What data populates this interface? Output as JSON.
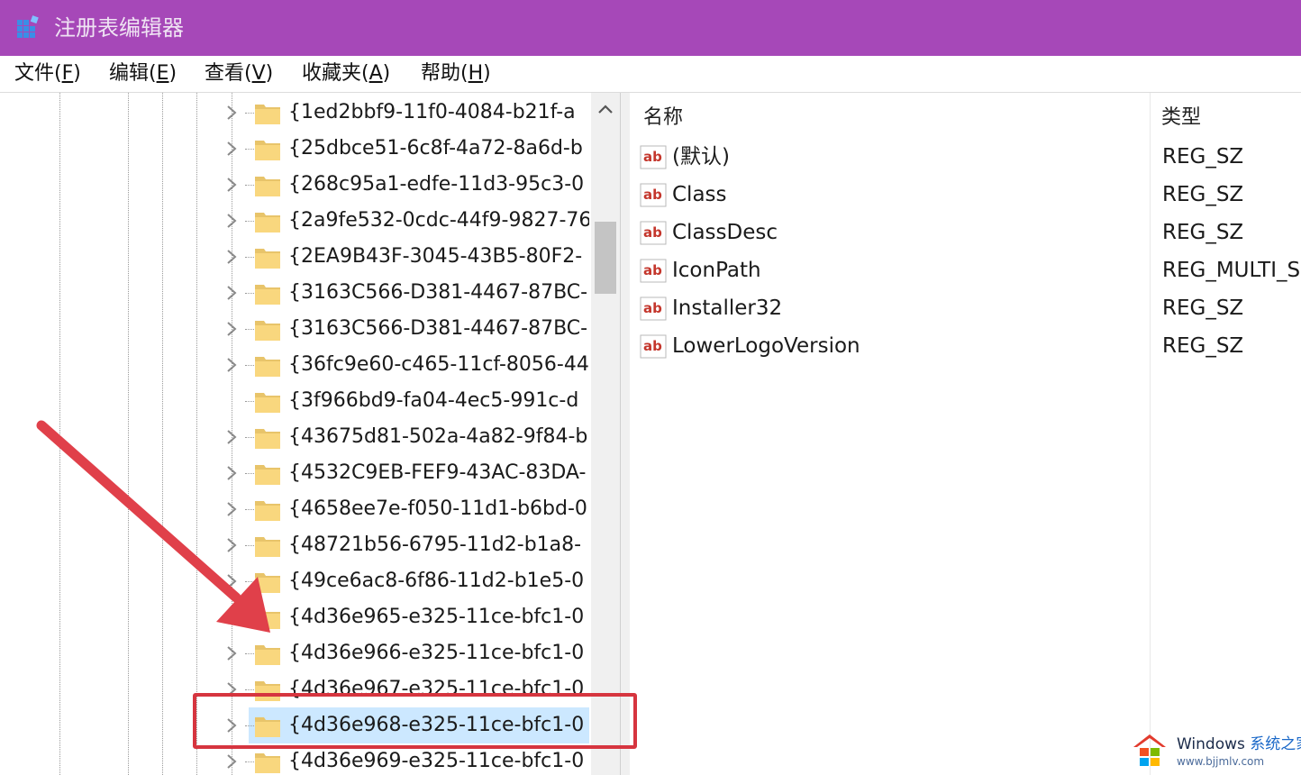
{
  "window": {
    "title": "注册表编辑器",
    "titlebar_color": "#a648b8"
  },
  "menu": [
    {
      "label": "文件(",
      "key": "F",
      "close": ")"
    },
    {
      "label": "编辑(",
      "key": "E",
      "close": ")"
    },
    {
      "label": "查看(",
      "key": "V",
      "close": ")"
    },
    {
      "label": "收藏夹(",
      "key": "A",
      "close": ")"
    },
    {
      "label": "帮助(",
      "key": "H",
      "close": ")"
    }
  ],
  "tree": {
    "items": [
      {
        "label": "{1ed2bbf9-11f0-4084-b21f-a",
        "expandable": true
      },
      {
        "label": "{25dbce51-6c8f-4a72-8a6d-b",
        "expandable": true
      },
      {
        "label": "{268c95a1-edfe-11d3-95c3-0",
        "expandable": true
      },
      {
        "label": "{2a9fe532-0cdc-44f9-9827-76",
        "expandable": true
      },
      {
        "label": "{2EA9B43F-3045-43B5-80F2-",
        "expandable": true
      },
      {
        "label": "{3163C566-D381-4467-87BC-",
        "expandable": true
      },
      {
        "label": "{3163C566-D381-4467-87BC-",
        "expandable": true
      },
      {
        "label": "{36fc9e60-c465-11cf-8056-44",
        "expandable": true
      },
      {
        "label": "{3f966bd9-fa04-4ec5-991c-d",
        "expandable": false
      },
      {
        "label": "{43675d81-502a-4a82-9f84-b",
        "expandable": true
      },
      {
        "label": "{4532C9EB-FEF9-43AC-83DA-",
        "expandable": true
      },
      {
        "label": "{4658ee7e-f050-11d1-b6bd-0",
        "expandable": true
      },
      {
        "label": "{48721b56-6795-11d2-b1a8-",
        "expandable": true
      },
      {
        "label": "{49ce6ac8-6f86-11d2-b1e5-0",
        "expandable": true
      },
      {
        "label": "{4d36e965-e325-11ce-bfc1-0",
        "expandable": true
      },
      {
        "label": "{4d36e966-e325-11ce-bfc1-0",
        "expandable": true
      },
      {
        "label": "{4d36e967-e325-11ce-bfc1-0",
        "expandable": true
      },
      {
        "label": "{4d36e968-e325-11ce-bfc1-0",
        "expandable": true,
        "selected": true
      },
      {
        "label": "{4d36e969-e325-11ce-bfc1-0",
        "expandable": true
      }
    ]
  },
  "list": {
    "columns": {
      "name": "名称",
      "type": "类型"
    },
    "rows": [
      {
        "name": "(默认)",
        "type": "REG_SZ"
      },
      {
        "name": "Class",
        "type": "REG_SZ"
      },
      {
        "name": "ClassDesc",
        "type": "REG_SZ"
      },
      {
        "name": "IconPath",
        "type": "REG_MULTI_S"
      },
      {
        "name": "Installer32",
        "type": "REG_SZ"
      },
      {
        "name": "LowerLogoVersion",
        "type": "REG_SZ"
      }
    ]
  },
  "annotation": {
    "color": "#d6353f"
  },
  "watermark": {
    "brand": "Windows",
    "brand_zh": "系统之家",
    "url": "www.bjjmlv.com"
  }
}
